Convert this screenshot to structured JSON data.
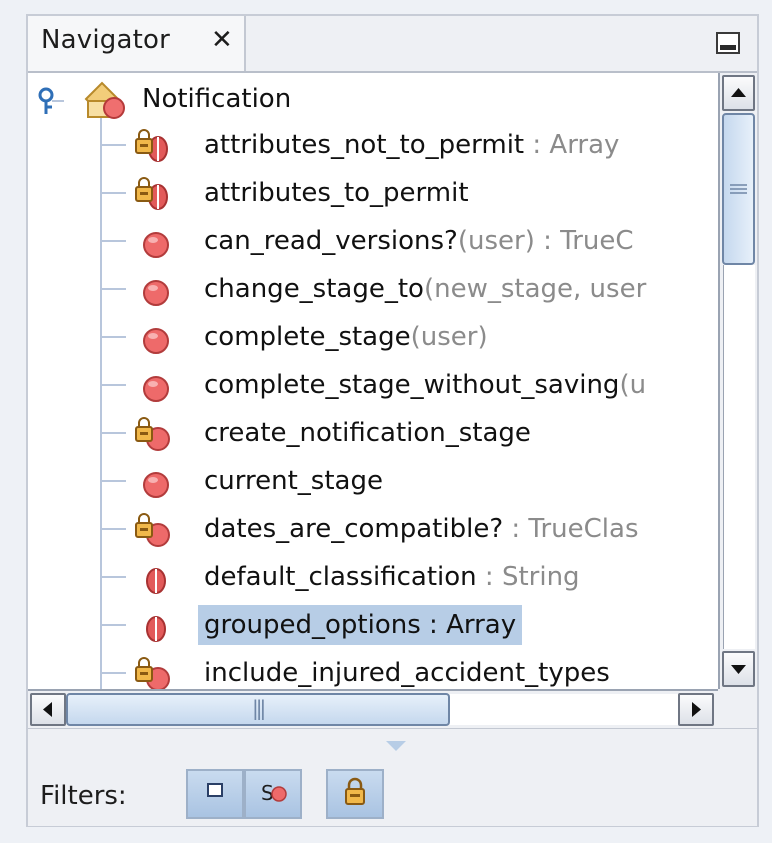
{
  "tab": {
    "title": "Navigator",
    "close_glyph": "✕"
  },
  "tree": {
    "root": {
      "label": "Notification",
      "icon": "class-icon",
      "expander": "expanded-key-icon"
    },
    "items": [
      {
        "name": "attributes_not_to_permit",
        "detail": " : Array",
        "icon": "protected-field-icon"
      },
      {
        "name": "attributes_to_permit",
        "detail": "",
        "icon": "protected-field-icon"
      },
      {
        "name": "can_read_versions?",
        "detail": "(user) : TrueC",
        "icon": "method-icon"
      },
      {
        "name": "change_stage_to",
        "detail": "(new_stage, user",
        "icon": "method-icon"
      },
      {
        "name": "complete_stage",
        "detail": "(user)",
        "icon": "method-icon"
      },
      {
        "name": "complete_stage_without_saving",
        "detail": "(u",
        "icon": "method-icon"
      },
      {
        "name": "create_notification_stage",
        "detail": "",
        "icon": "protected-method-icon"
      },
      {
        "name": "current_stage",
        "detail": "",
        "icon": "method-icon"
      },
      {
        "name": "dates_are_compatible?",
        "detail": " : TrueClas",
        "icon": "protected-method-icon"
      },
      {
        "name": "default_classification",
        "detail": " : String",
        "icon": "field-icon"
      },
      {
        "name": "grouped_options",
        "detail": " : Array",
        "icon": "field-icon",
        "selected": true
      },
      {
        "name": "include_injured_accident_types",
        "detail": "",
        "icon": "protected-method-icon"
      }
    ]
  },
  "hscroll_thumb_glyph": "|||",
  "filters": {
    "label": "Filters:",
    "buttons": [
      {
        "name": "filter-fields-button",
        "icon": "square-icon"
      },
      {
        "name": "filter-static-button",
        "icon": "static-member-icon"
      },
      {
        "name": "filter-nonpublic-button",
        "icon": "lock-icon"
      }
    ]
  },
  "colors": {
    "selection": "#b7cde6",
    "method": "#e24b4b",
    "tree_line": "#b8c6dc"
  }
}
